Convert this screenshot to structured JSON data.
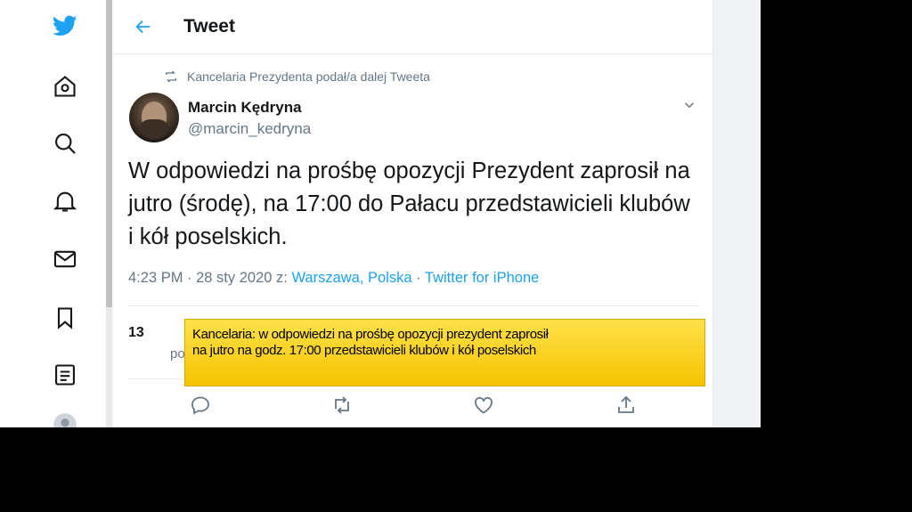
{
  "header": {
    "title": "Tweet"
  },
  "retweet_context": "Kancelaria Prezydenta podał/a dalej Tweeta",
  "author": {
    "name": "Marcin Kędryna",
    "handle": "@marcin_kedryna"
  },
  "tweet": {
    "line1": "W odpowiedzi na prośbę opozycji Prezydent zaprosił na",
    "line2": "jutro (środę), na 17:00 do Pałacu przedstawicieli klubów",
    "line3": "i kół poselskich."
  },
  "meta": {
    "time_date": "4:23 PM · 28 sty 2020 z: ",
    "location": "Warszawa, Polska",
    "separator": " · ",
    "source": "Twitter for iPhone"
  },
  "stats": {
    "count": "13",
    "label_partial": "po"
  },
  "caption": {
    "line1": "Kancelaria: w odpowiedzi na prośbę opozycji prezydent zaprosił",
    "line2": "na jutro na godz. 17:00 przedstawicieli klubów i kół poselskich"
  },
  "nav": [
    "twitter-logo-icon",
    "home-icon",
    "explore-icon",
    "notifications-icon",
    "messages-icon",
    "bookmarks-icon",
    "lists-icon",
    "profile-icon"
  ],
  "colors": {
    "accent": "#1da1f2",
    "text": "#14171a",
    "muted": "#657786",
    "caption_bg": "#ffd52a"
  }
}
